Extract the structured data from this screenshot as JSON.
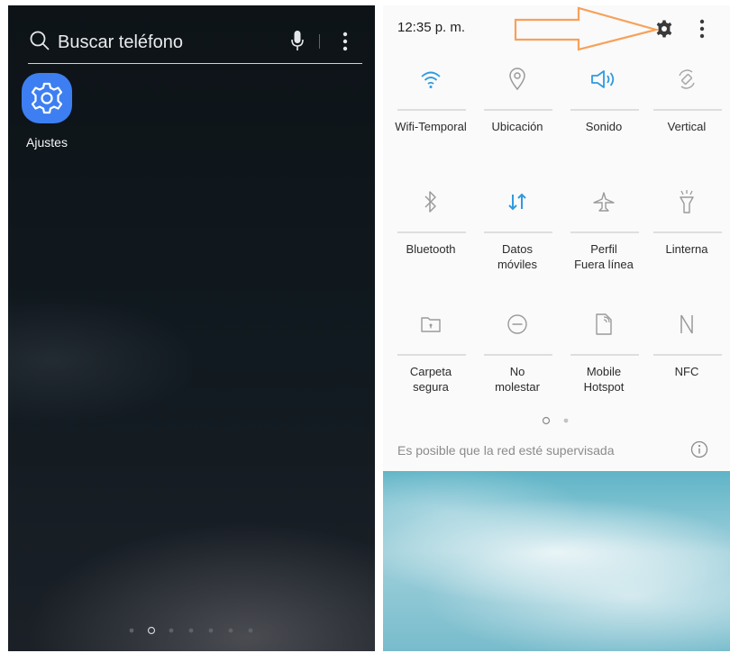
{
  "home": {
    "search_placeholder": "Buscar teléfono",
    "app_label": "Ajustes",
    "accent": "#3d7ff2",
    "page_count": 7,
    "current_page": 2
  },
  "quick_panel": {
    "time": "12:35 p. m.",
    "notice": "Es posible que la red esté supervisada",
    "active_color": "#2f9ae0",
    "annotation_color": "#f7a15a",
    "tiles": [
      {
        "label": "Wifi-Temporal",
        "icon": "wifi-icon",
        "active": true
      },
      {
        "label": "Ubicación",
        "icon": "location-icon",
        "active": false
      },
      {
        "label": "Sonido",
        "icon": "sound-icon",
        "active": true
      },
      {
        "label": "Vertical",
        "icon": "rotation-icon",
        "active": false
      },
      {
        "label": "Bluetooth",
        "icon": "bluetooth-icon",
        "active": false
      },
      {
        "label": "Datos\nmóviles",
        "icon": "mobile-data-icon",
        "active": true
      },
      {
        "label": "Perfil\nFuera línea",
        "icon": "airplane-icon",
        "active": false
      },
      {
        "label": "Linterna",
        "icon": "flashlight-icon",
        "active": false
      },
      {
        "label": "Carpeta\nsegura",
        "icon": "secure-folder-icon",
        "active": false
      },
      {
        "label": "No\nmolestar",
        "icon": "do-not-disturb-icon",
        "active": false
      },
      {
        "label": "Mobile\nHotspot",
        "icon": "hotspot-icon",
        "active": false
      },
      {
        "label": "NFC",
        "icon": "nfc-icon",
        "active": false
      }
    ],
    "page_count": 2,
    "current_page": 1
  }
}
